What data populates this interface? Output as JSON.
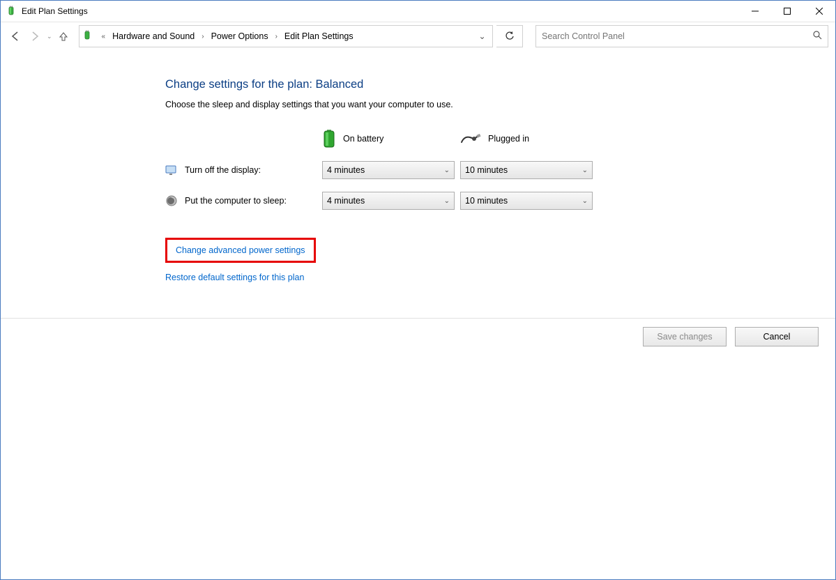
{
  "window": {
    "title": "Edit Plan Settings"
  },
  "breadcrumbs": {
    "seg1": "Hardware and Sound",
    "seg2": "Power Options",
    "seg3": "Edit Plan Settings"
  },
  "search": {
    "placeholder": "Search Control Panel"
  },
  "page": {
    "heading": "Change settings for the plan: Balanced",
    "subtext": "Choose the sleep and display settings that you want your computer to use.",
    "col_battery": "On battery",
    "col_plugged": "Plugged in",
    "rows": {
      "display": {
        "label": "Turn off the display:",
        "battery": "4 minutes",
        "plugged": "10 minutes"
      },
      "sleep": {
        "label": "Put the computer to sleep:",
        "battery": "4 minutes",
        "plugged": "10 minutes"
      }
    },
    "link_advanced": "Change advanced power settings",
    "link_restore": "Restore default settings for this plan"
  },
  "footer": {
    "save": "Save changes",
    "cancel": "Cancel"
  }
}
